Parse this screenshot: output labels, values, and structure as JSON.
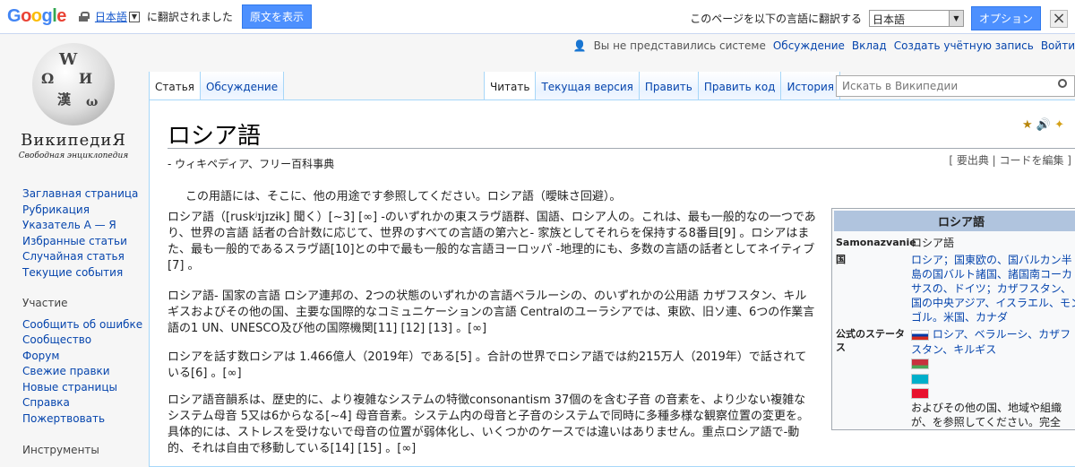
{
  "google_bar": {
    "logo_letters": [
      {
        "c": "G",
        "color": "#4285f4"
      },
      {
        "c": "o",
        "color": "#ea4335"
      },
      {
        "c": "o",
        "color": "#fbbc05"
      },
      {
        "c": "g",
        "color": "#4285f4"
      },
      {
        "c": "l",
        "color": "#34a853"
      },
      {
        "c": "e",
        "color": "#ea4335"
      }
    ],
    "lang": "日本語",
    "translated_text": "に翻訳されました",
    "show_original": "原文を表示",
    "translate_to": "このページを以下の言語に翻訳する",
    "selected_lang": "日本語",
    "options": "オプション",
    "close": "×"
  },
  "personal": {
    "anon": "Вы не представились системе",
    "talk": "Обсуждение",
    "login": "Вклад",
    "create": "Создать учётную запись",
    "enter": "Войти"
  },
  "logo": {
    "name": "ВикипедиЯ",
    "sub": "Свободная энциклопедия"
  },
  "nav": {
    "main": [
      "Заглавная страница",
      "Рубрикация",
      "Указатель А — Я",
      "Избранные статьи",
      "Случайная статья",
      "Текущие события"
    ],
    "participation_head": "Участие",
    "participation": [
      "Сообщить об ошибке",
      "Сообщество",
      "Форум",
      "Свежие правки",
      "Новые страницы",
      "Справка",
      "Пожертвовать"
    ],
    "tools_head": "Инструменты"
  },
  "tabs": {
    "left": [
      "Статья",
      "Обсуждение"
    ],
    "right": [
      "Читать",
      "Текущая версия",
      "Править",
      "Править код",
      "История"
    ]
  },
  "search": {
    "placeholder": "Искать в Википедии"
  },
  "article": {
    "title": "ロシア語",
    "tagline": "- ウィキペディア、フリー百科事典",
    "edit_links": "[ 要出典 | コードを編集 ]",
    "hatnote": "この用語には、そこに、他の用途です参照してください。ロシア語（曖昧さ回避）。",
    "p1": "ロシア語（[ruskʲɪjɪzɨk] 聞く）[~3] [∞] -のいずれかの東スラヴ語群、国語、ロシア人の。これは、最も一般的なの一つであり、世界の言語 話者の合計数に応じて、世界のすべての言語の第六と- 家族としてそれらを保持する8番目[9] 。ロシアはまた、最も一般的であるスラヴ語[10]との中で最も一般的な言語ヨーロッパ -地理的にも、多数の言語の話者としてネイティブ[7] 。",
    "p2": "ロシア語- 国家の言語 ロシア連邦の、2つの状態のいずれかの言語ベラルーシの、のいずれかの公用語 カザフスタン、キルギスおよびその他の国、主要な国際的なコミュニケーションの言語 Centralのユーラシアでは、東欧、旧ソ連、6つの作業言語の1 UN、UNESCO及び他の国際機関[11] [12] [13] 。[∞]",
    "p3": "ロシアを話す数ロシアは 1.466億人（2019年）である[5] 。合計の世界でロシア語では約215万人（2019年）で話されている[6] 。[∞]",
    "p4": "ロシア語音韻系は、歴史的に、より複雑なシステムの特徴consonantism 37個のを含む子音 の音素を、より少ない複雑なシステム母音 5又は6からなる[~4] 母音音素。システム内の母音と子音のシステムで同時に多種多様な観察位置の変更を。具体的には、ストレスを受けないで母音の位置が弱体化し、いくつかのケースでは違いはありません。重点ロシア語で-動的、それは自由で移動している[14] [15] 。[∞]"
  },
  "infobox": {
    "title": "ロシア語",
    "self_key": "Samonazvanie",
    "self_val": "ロシア語",
    "country_key": "国",
    "country_val": "ロシア；国東欧の、国バルカン半島の国バルト諸国、諸国南コーカサスの、ドイツ；カザフスタン、国の中央アジア、イスラエル、モンゴル。米国、カナダ",
    "status_key": "公式のステータス",
    "status_val": "ロシア、ベラルーシ、カザフスタン、キルギス",
    "status_tail": "およびその他の国、地域や組織が、を参照してください。完全"
  }
}
